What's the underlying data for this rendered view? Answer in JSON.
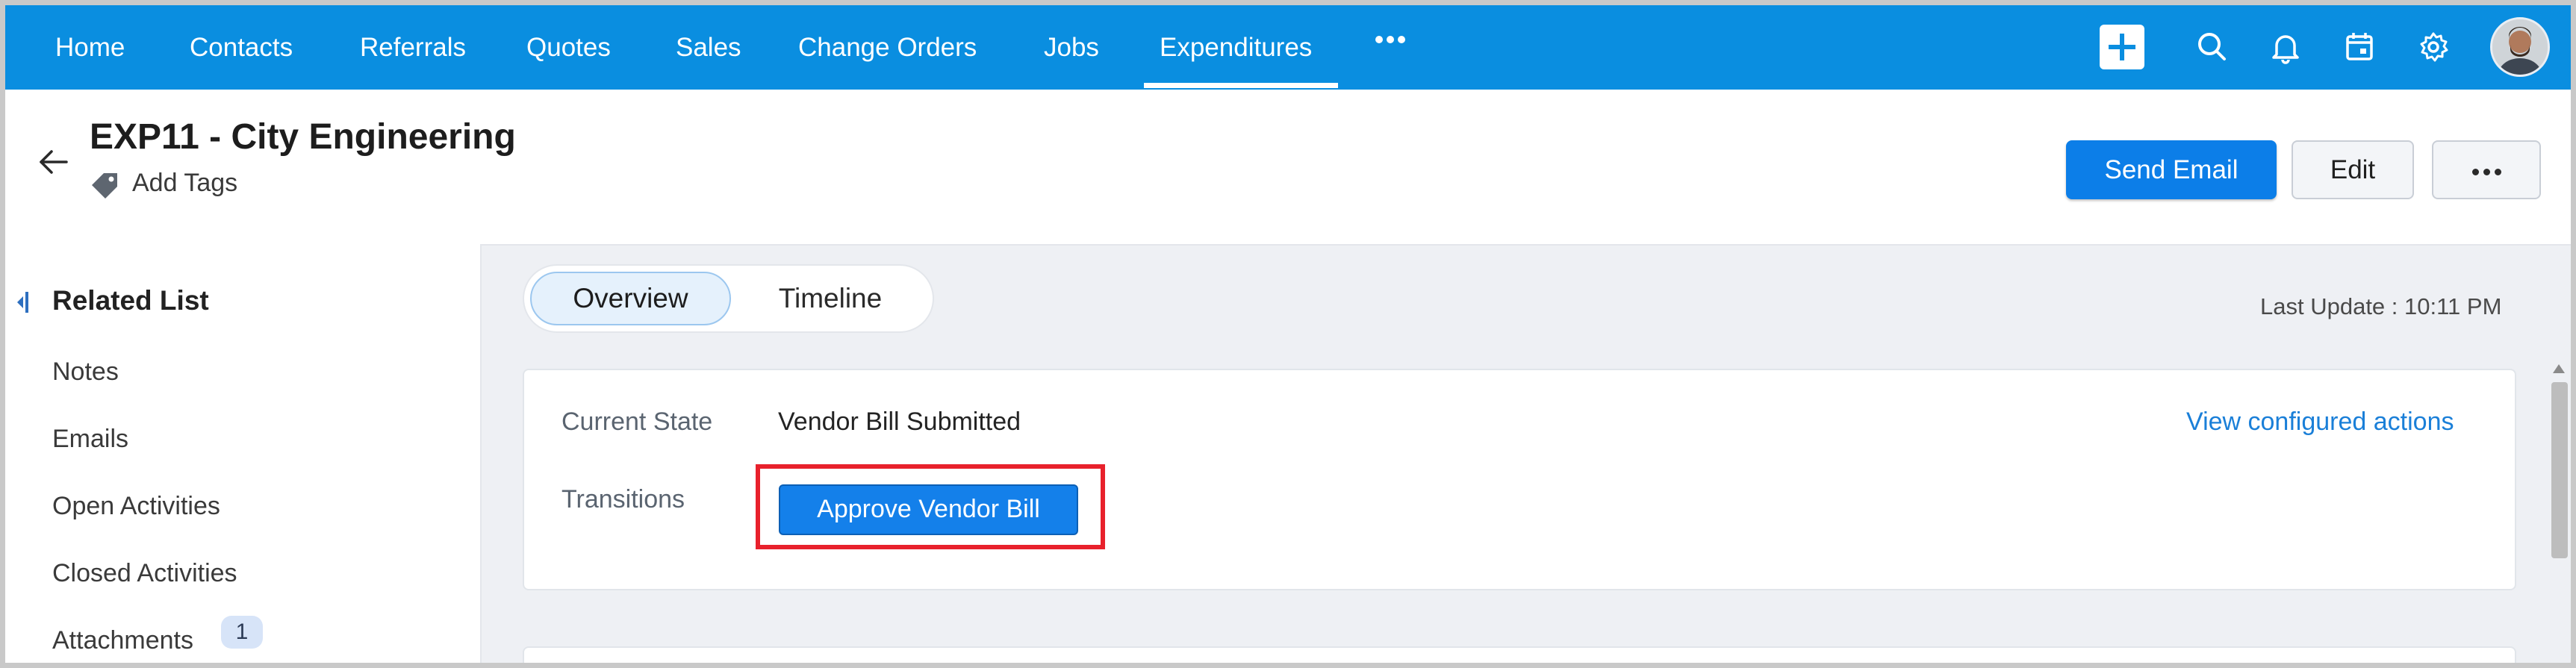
{
  "nav": {
    "items": [
      "Home",
      "Contacts",
      "Referrals",
      "Quotes",
      "Sales",
      "Change Orders",
      "Jobs",
      "Expenditures"
    ],
    "active": "Expenditures",
    "icons": [
      "plus-icon",
      "search-icon",
      "bell-icon",
      "calendar-icon",
      "gear-icon"
    ],
    "accent": "#0a8ee0"
  },
  "record": {
    "title": "EXP11 - City Engineering",
    "add_tags": "Add Tags",
    "send_email": "Send Email",
    "edit": "Edit"
  },
  "sidebar": {
    "title": "Related List",
    "items": [
      {
        "label": "Notes"
      },
      {
        "label": "Emails"
      },
      {
        "label": "Open Activities"
      },
      {
        "label": "Closed Activities"
      },
      {
        "label": "Attachments",
        "count": "1"
      }
    ]
  },
  "tabs": {
    "overview": "Overview",
    "timeline": "Timeline",
    "active": "Overview"
  },
  "last_update": "Last Update : 10:11 PM",
  "blueprint": {
    "current_state_label": "Current State",
    "current_state_value": "Vendor Bill Submitted",
    "transitions_label": "Transitions",
    "transition_button": "Approve Vendor Bill",
    "view_actions_link": "View configured actions"
  }
}
